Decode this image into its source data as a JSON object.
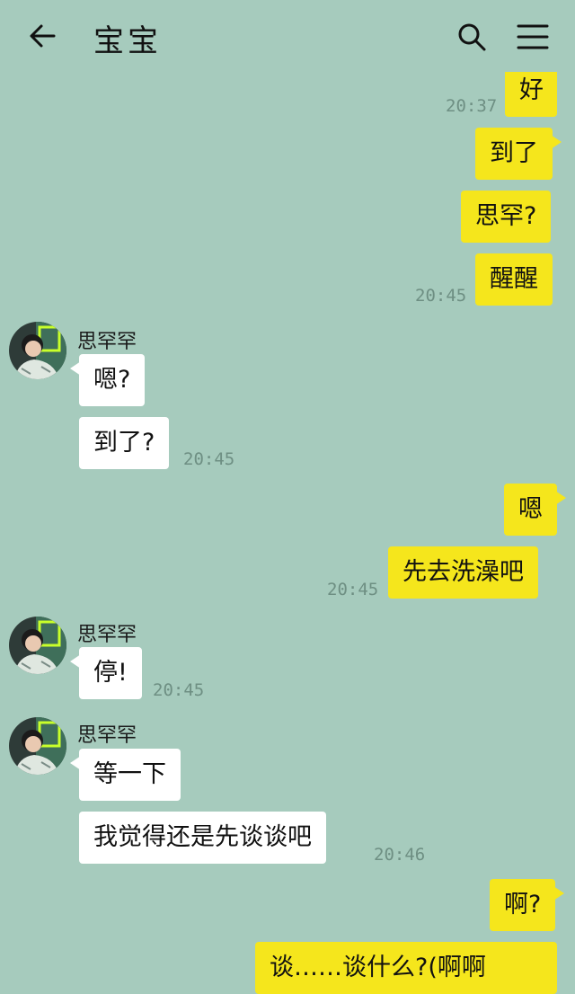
{
  "header": {
    "title": "宝宝",
    "back_icon": "arrow-left-icon",
    "search_icon": "search-icon",
    "menu_icon": "menu-icon"
  },
  "contact": {
    "name": "思罕罕"
  },
  "colors": {
    "background": "#a6cbbd",
    "my_bubble": "#f5e61c",
    "their_bubble": "#ffffff"
  },
  "messages": {
    "m1": "好",
    "t1": "20:37",
    "m2": "到了",
    "m3": "思罕?",
    "m4": "醒醒",
    "t2": "20:45",
    "r1": "嗯?",
    "r2": "到了?",
    "t3": "20:45",
    "m5": "嗯",
    "m6": "先去洗澡吧",
    "t4": "20:45",
    "r3": "停!",
    "t5": "20:45",
    "r4": "等一下",
    "r5": "我觉得还是先谈谈吧",
    "t6": "20:46",
    "m7": "啊?",
    "m8": "谈……谈什么?(啊啊"
  }
}
